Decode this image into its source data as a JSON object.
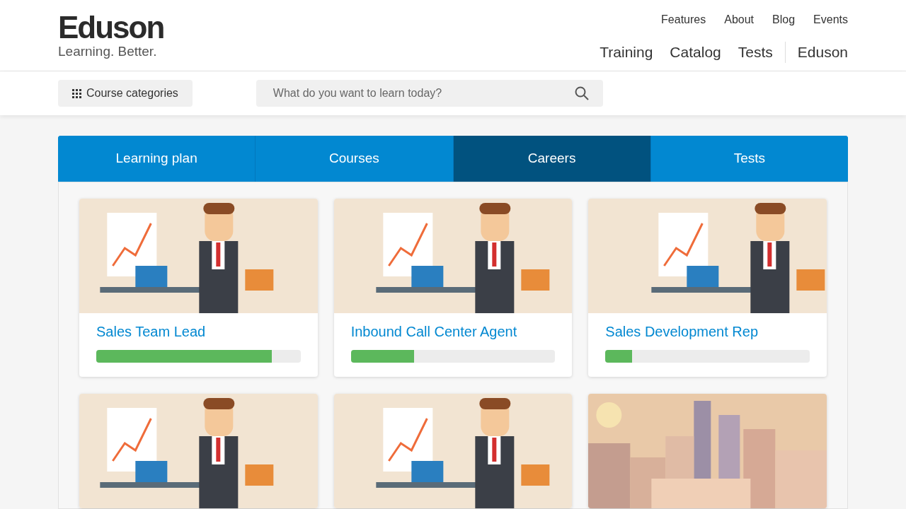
{
  "logo": {
    "name": "Eduson",
    "tagline": "Learning. Better."
  },
  "top_links": [
    "Features",
    "About",
    "Blog",
    "Events"
  ],
  "main_links": [
    "Training",
    "Catalog",
    "Tests",
    "Eduson"
  ],
  "categories_button": "Course categories",
  "search": {
    "placeholder": "What do you want to learn today?"
  },
  "tabs": [
    {
      "label": "Learning plan",
      "selected": false
    },
    {
      "label": "Courses",
      "selected": false
    },
    {
      "label": "Careers",
      "selected": true
    },
    {
      "label": "Tests",
      "selected": false
    }
  ],
  "cards": [
    {
      "title": "Sales Team Lead",
      "level": 0.86,
      "kind": "office"
    },
    {
      "title": "Inbound Call Center Agent",
      "level": 0.31,
      "kind": "office"
    },
    {
      "title": "Sales Development Rep",
      "level": 0.13,
      "kind": "office"
    },
    {
      "kind": "office"
    },
    {
      "kind": "office"
    },
    {
      "kind": "city"
    }
  ]
}
